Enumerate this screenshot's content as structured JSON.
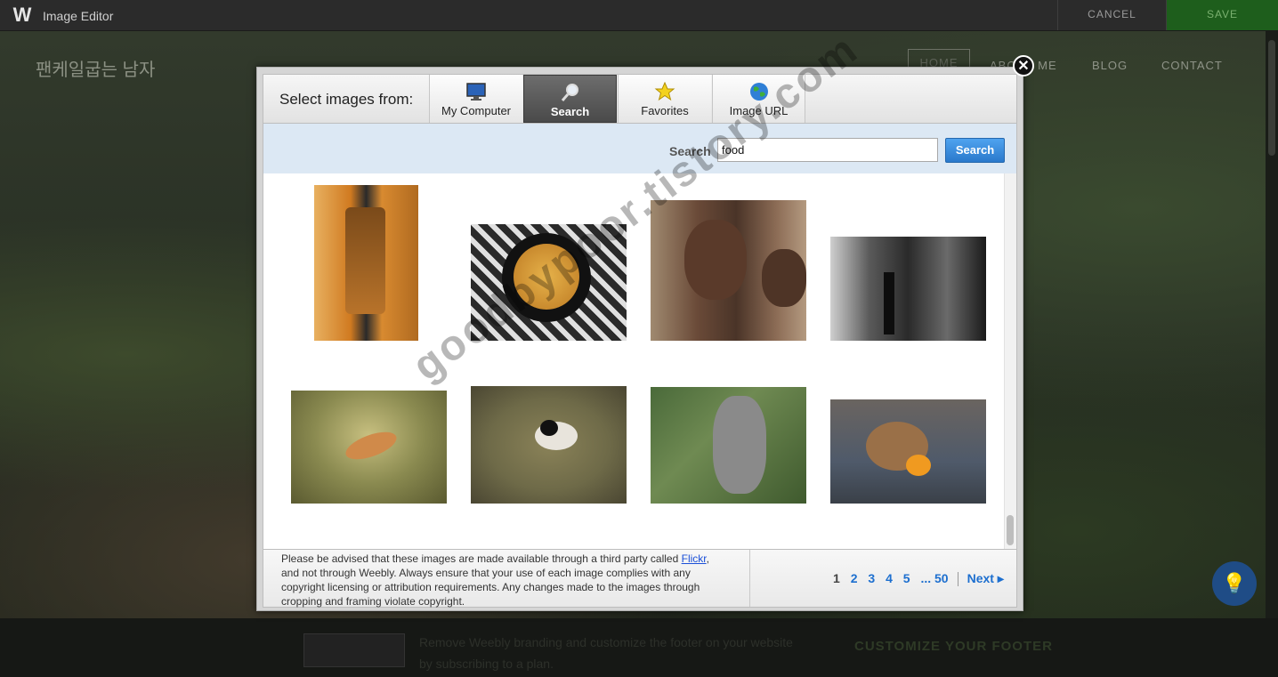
{
  "app": {
    "title": "Image Editor",
    "cancel": "CANCEL",
    "save": "SAVE"
  },
  "site": {
    "title": "팬케일굽는 남자",
    "nav": [
      "HOME",
      "ABOUT ME",
      "BLOG",
      "CONTACT"
    ],
    "footer_text": "Remove Weebly branding and customize the footer on your website by subscribing to a plan.",
    "footer_cta": "CUSTOMIZE YOUR FOOTER"
  },
  "modal": {
    "select_label": "Select images from:",
    "tabs": [
      {
        "label": "My Computer",
        "icon": "monitor-icon"
      },
      {
        "label": "Search",
        "icon": "magnifier-icon",
        "active": true
      },
      {
        "label": "Favorites",
        "icon": "star-icon"
      },
      {
        "label": "Image URL",
        "icon": "globe-icon"
      }
    ],
    "search": {
      "label": "Search",
      "value": "food",
      "button": "Search"
    },
    "notice": {
      "before": "Please be advised that these images are made available through a third party called ",
      "link": "Flickr",
      "after": ", and not through Weebly. Always ensure that your use of each image complies with any copyright licensing or attribution requirements. Any changes made to the images through cropping and framing violate copyright."
    },
    "pager": {
      "pages": [
        "1",
        "2",
        "3",
        "4",
        "5"
      ],
      "ellipsis": "... 50",
      "next": "Next ▸"
    }
  },
  "results": [
    {
      "name": "whisky-bottle-photo",
      "color": "#c9782a"
    },
    {
      "name": "bowl-of-food-photo",
      "color": "#c89a3a"
    },
    {
      "name": "children-portrait-photo",
      "color": "#7a5a44"
    },
    {
      "name": "street-scene-bw-photo",
      "color": "#3a3a3a"
    },
    {
      "name": "bird-on-branch-photo",
      "color": "#8a8a50"
    },
    {
      "name": "chickadee-photo",
      "color": "#6e6a48"
    },
    {
      "name": "koala-photo",
      "color": "#5f7a4a"
    },
    {
      "name": "chipmunk-photo",
      "color": "#6a6460"
    }
  ],
  "watermark": "goodbypoor.tistory.com"
}
